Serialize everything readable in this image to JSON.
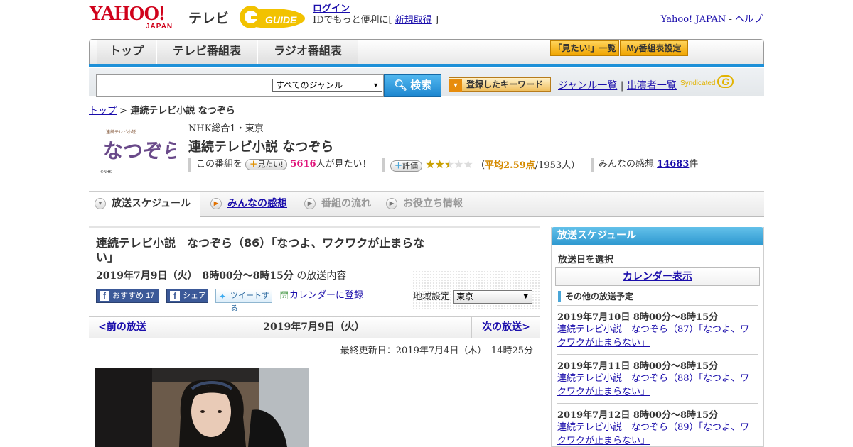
{
  "header": {
    "logo_text": "YAHOO!",
    "logo_sub": "JAPAN",
    "service": "テレビ",
    "partner_logo": "G GUIDE",
    "login_label": "ログイン",
    "login_sub_pre": "IDでもっと便利に[",
    "signup_label": "新規取得",
    "login_sub_post": "]",
    "yahoo_japan_link": "Yahoo! JAPAN",
    "sep": "-",
    "help_link": "ヘルプ"
  },
  "nav": {
    "tabs": [
      {
        "label": "トップ"
      },
      {
        "label": "テレビ番組表"
      },
      {
        "label": "ラジオ番組表"
      }
    ],
    "mitai_list": "「見たい!」一覧",
    "my_program": "My番組表設定"
  },
  "search": {
    "genre_selected": "すべてのジャンル",
    "button": "検索",
    "keyword_button": "登録したキーワード",
    "genre_list_link": "ジャンル一覧",
    "divider": "|",
    "performer_link": "出演者一覧",
    "syndicated": "Syndicated"
  },
  "breadcrumb": {
    "top": "トップ",
    "sep": ">",
    "current": "連続テレビ小説 なつぞら"
  },
  "program": {
    "thumb_title": "なつぞら",
    "thumb_caption": "連続テレビ小説",
    "thumb_credit": "©NHK",
    "channel": "NHK総合1・東京",
    "title": "連続テレビ小説 なつぞら",
    "want_pre": "この番組を",
    "want_button": "見たい!",
    "want_count": "5616",
    "want_post": "人が見たい！",
    "rate_button": "評価",
    "rating_stars": 2.5,
    "avg_open": "（",
    "avg_label": "平均2.59点",
    "avg_count": "/1953人）",
    "impressions_label": "みんなの感想",
    "impressions_count": "14683",
    "impressions_unit": "件"
  },
  "subtabs": [
    {
      "label": "放送スケジュール",
      "active": true
    },
    {
      "label": "みんなの感想",
      "link": true
    },
    {
      "label": "番組の流れ"
    },
    {
      "label": "お役立ち情報"
    }
  ],
  "episode": {
    "title": "連続テレビ小説　なつぞら（86）「なつよ、ワクワクが止まらない」",
    "date": "2019年7月9日（火）　8時00分～8時15分",
    "date_suffix": "の放送内容",
    "recommend_label": "おすすめ",
    "recommend_count": "17",
    "share_label": "シェア",
    "tweet_label": "ツイートする",
    "calendar_label": "カレンダーに登録",
    "region_label": "地域設定",
    "region_value": "東京",
    "prev_label": "<前の放送",
    "current_date": "2019年7月9日（火）",
    "next_label": "次の放送>",
    "updated": "最終更新日：2019年7月4日（木）　14時25分"
  },
  "sidebar": {
    "header": "放送スケジュール",
    "select_day": "放送日を選択",
    "calendar_button": "カレンダー表示",
    "other_header": "その他の放送予定",
    "items": [
      {
        "date": "2019年7月10日  8時00分～8時15分",
        "title": "連続テレビ小説　なつぞら（87）「なつよ、ワクワクが止まらない」"
      },
      {
        "date": "2019年7月11日  8時00分～8時15分",
        "title": "連続テレビ小説　なつぞら（88）「なつよ、ワクワクが止まらない」"
      },
      {
        "date": "2019年7月12日  8時00分～8時15分",
        "title": "連続テレビ小説　なつぞら（89）「なつよ、ワクワクが止まらない」"
      }
    ]
  }
}
